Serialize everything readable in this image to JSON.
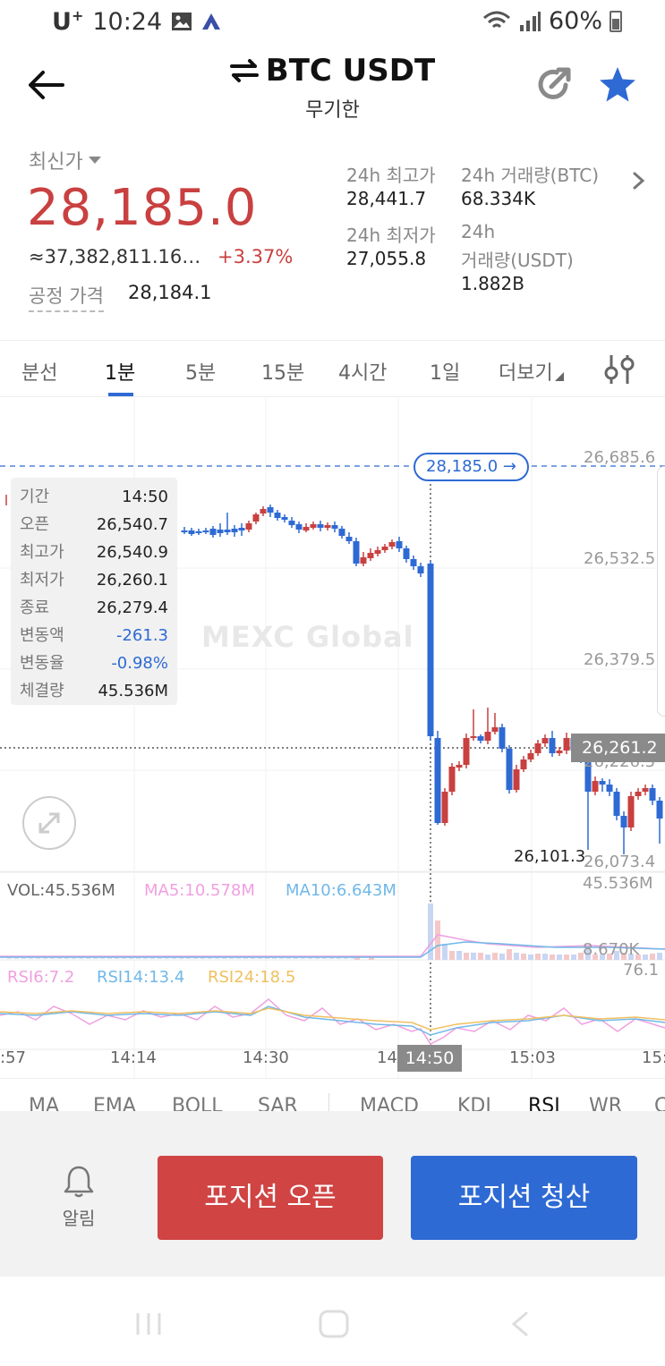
{
  "status_bar": {
    "carrier": "U",
    "carrier_sup": "+",
    "time": "10:24",
    "battery": "60%"
  },
  "header": {
    "title": "BTC USDT",
    "subtitle": "무기한"
  },
  "price": {
    "last_label": "최신가",
    "last_price": "28,185.0",
    "approx_krw": "≈37,382,811.16…",
    "change_pct": "+3.37%",
    "fair_label": "공정 가격",
    "fair_value": "28,184.1",
    "high_label": "24h 최고가",
    "high_value": "28,441.7",
    "low_label": "24h 최저가",
    "low_value": "27,055.8",
    "vol_btc_label": "24h 거래량(BTC)",
    "vol_btc_value": "68.334K",
    "vol_usdt_label_1": "24h",
    "vol_usdt_label_2": "거래량(USDT)",
    "vol_usdt_value": "1.882B",
    "colors": {
      "up": "#c94040",
      "down": "#2e6ad4"
    }
  },
  "timeframes": {
    "items": [
      "분선",
      "1분",
      "5분",
      "15분",
      "4시간",
      "1일",
      "더보기"
    ],
    "active": "1분"
  },
  "chart": {
    "right_axis": [
      "26,685.6",
      "26,532.5",
      "26,379.5",
      "26,226.5",
      "26,073.4"
    ],
    "last_price_pill": "28,185.0 →",
    "crosshair_price": "26,261.2",
    "min_label": "26,101.3",
    "watermark": "MEXC Global",
    "tooltip": [
      {
        "k": "기간",
        "v": "14:50"
      },
      {
        "k": "오픈",
        "v": "26,540.7"
      },
      {
        "k": "최고가",
        "v": "26,540.9"
      },
      {
        "k": "최저가",
        "v": "26,260.1"
      },
      {
        "k": "종료",
        "v": "26,279.4"
      },
      {
        "k": "변동액",
        "v": "-261.3"
      },
      {
        "k": "변동율",
        "v": "-0.98%"
      },
      {
        "k": "체결량",
        "v": "45.536M"
      }
    ],
    "volume": {
      "vol": "VOL:45.536M",
      "ma5": "MA5:10.578M",
      "ma10": "MA10:6.643M",
      "axis_top": "45.536M",
      "axis_bottom": "8.670K"
    },
    "rsi": {
      "rsi6": "RSI6:7.2",
      "rsi14": "RSI14:13.4",
      "rsi24": "RSI24:18.5",
      "axis_top": "76.1"
    },
    "time_axis": [
      ":57",
      "14:14",
      "14:30",
      "14",
      "15:03",
      "15:"
    ],
    "time_tag": "14:50",
    "series_colors": {
      "ma5": "#f0a0e0",
      "ma10": "#70b8e8",
      "rsi24": "#f0c060"
    }
  },
  "indicators": {
    "items": [
      "MA",
      "EMA",
      "BOLL",
      "SAR",
      "MACD",
      "KDJ",
      "RSI",
      "WR",
      "C"
    ],
    "active": "RSI"
  },
  "actions": {
    "alarm": "알림",
    "open": "포지션 오픈",
    "close": "포지션 청산"
  }
}
